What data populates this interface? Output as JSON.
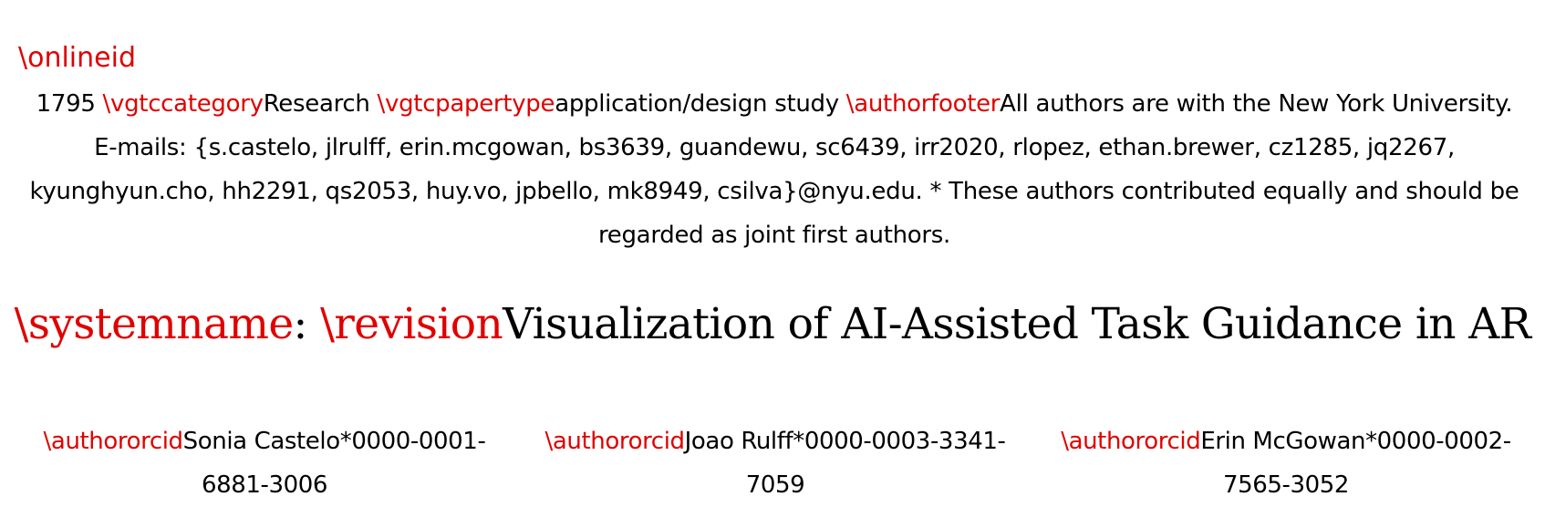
{
  "online_id": {
    "command": "\\onlineid",
    "value": "1795"
  },
  "category": {
    "command": "\\vgtccategory",
    "value": "Research"
  },
  "paper_type": {
    "command": "\\vgtcpapertype",
    "value": "application/design study"
  },
  "author_footer": {
    "command": "\\authorfooter",
    "text": "All authors are with the New York University. E-mails: {s.castelo, jlrulff, erin.mcgowan, bs3639, guandewu, sc6439, irr2020, rlopez, ethan.brewer, cz1285, jq2267, kyunghyun.cho, hh2291, qs2053, huy.vo, jpbello, mk8949, csilva}@nyu.edu. * These authors contributed equally and should be regarded as joint first authors."
  },
  "title": {
    "system_command": "\\systemname",
    "separator": ": ",
    "revision_command": "\\revision",
    "text": "Visualization of AI-Assisted Task Guidance in AR"
  },
  "authors": [
    {
      "command": "\\authororcid",
      "text": "Sonia Castelo*0000-0001-6881-3006"
    },
    {
      "command": "\\authororcid",
      "text": "Joao Rulff*0000-0003-3341-7059"
    },
    {
      "command": "\\authororcid",
      "text": "Erin McGowan*0000-0002-7565-3052"
    }
  ],
  "colors": {
    "command": "#e00000",
    "text": "#000000",
    "background": "#ffffff"
  }
}
